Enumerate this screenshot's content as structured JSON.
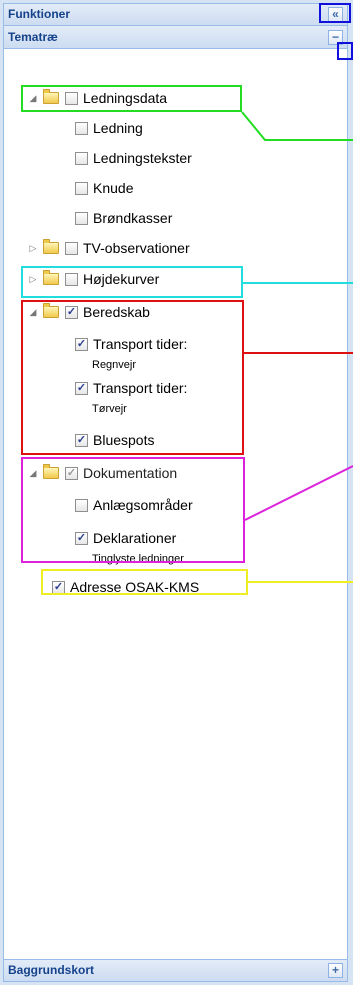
{
  "panel": {
    "title": "Funktioner",
    "collapse_glyph": "«",
    "theme_title": "Tematræ",
    "theme_collapse_glyph": "−",
    "base_title": "Baggrundskort",
    "base_expand_glyph": "+"
  },
  "tree": {
    "ledningsdata": {
      "label": "Ledningsdata",
      "expanded": true,
      "checked": false
    },
    "ledning": {
      "label": "Ledning",
      "checked": false
    },
    "ledningstekster": {
      "label": "Ledningstekster",
      "checked": false
    },
    "knude": {
      "label": "Knude",
      "checked": false
    },
    "brondkasser": {
      "label": "Brøndkasser",
      "checked": false
    },
    "tv": {
      "label": "TV-observationer",
      "expanded": false,
      "checked": false
    },
    "hojdekurver": {
      "label": "Højdekurver",
      "expanded": false,
      "checked": false
    },
    "beredskab": {
      "label": "Beredskab",
      "expanded": true,
      "checked": true
    },
    "transport_regn": {
      "label": "Transport tider:",
      "sub": "Regnvejr",
      "checked": true
    },
    "transport_torv": {
      "label": "Transport tider:",
      "sub": "Tørvejr",
      "checked": true
    },
    "bluespots": {
      "label": "Bluespots",
      "checked": true
    },
    "dokumentation": {
      "label": "Dokumentation",
      "expanded": true,
      "checked": true
    },
    "anlaeg": {
      "label": "Anlægsområder",
      "checked": false
    },
    "deklarationer": {
      "label": "Deklarationer",
      "sub": "Tinglyste ledninger",
      "checked": true
    },
    "adresse": {
      "label": "Adresse OSAK-KMS",
      "checked": true
    }
  },
  "icons": {
    "expanded": "◢",
    "collapsed": "▷"
  },
  "annotation_colors": {
    "green": "#22dd22",
    "cyan": "#22dddd",
    "red": "#dd1111",
    "magenta": "#dd22dd",
    "yellow": "#eeee22",
    "blue": "#1111dd"
  }
}
